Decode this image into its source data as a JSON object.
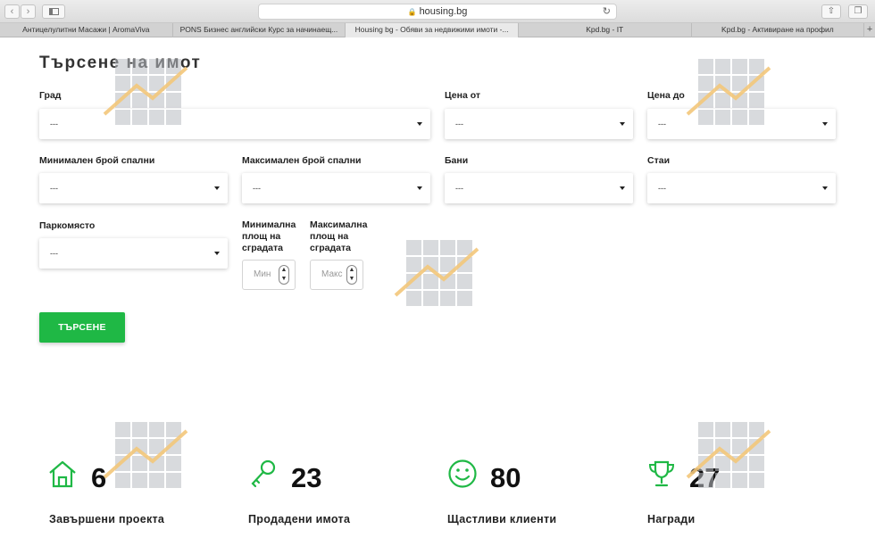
{
  "browser": {
    "url": "housing.bg",
    "tabs": [
      "Антицелулитни Масажи | AromaViva",
      "PONS Бизнес английски Курс за начинаещ...",
      "Housing bg - Обяви за недвижими имоти -...",
      "Kpd.bg - IT",
      "Kpd.bg - Активиране на профил"
    ],
    "active_tab": 2,
    "new_tab_label": "+"
  },
  "search": {
    "title": "Търсене на имот",
    "fields": {
      "city": {
        "label": "Град",
        "value": "---"
      },
      "price_from": {
        "label": "Цена от",
        "value": "---"
      },
      "price_to": {
        "label": "Цена до",
        "value": "---"
      },
      "min_bedrooms": {
        "label": "Минимален брой спални",
        "value": "---"
      },
      "max_bedrooms": {
        "label": "Максимален брой спални",
        "value": "---"
      },
      "bathrooms": {
        "label": "Бани",
        "value": "---"
      },
      "rooms": {
        "label": "Стаи",
        "value": "---"
      },
      "parking": {
        "label": "Паркомясто",
        "value": "---"
      },
      "min_area": {
        "label_lines": [
          "Минимална",
          "площ на",
          "сградата"
        ],
        "placeholder": "Мин"
      },
      "max_area": {
        "label_lines": [
          "Максимална",
          "площ на",
          "сградата"
        ],
        "placeholder": "Макс"
      }
    },
    "submit_label": "ТЪРСЕНЕ"
  },
  "stats": [
    {
      "icon": "house-icon",
      "value": "6",
      "label": "Завършени проекта"
    },
    {
      "icon": "key-icon",
      "value": "23",
      "label": "Продадени имота"
    },
    {
      "icon": "smiley-icon",
      "value": "80",
      "label": "Щастливи клиенти"
    },
    {
      "icon": "trophy-icon",
      "value": "27",
      "label": "Награди"
    }
  ],
  "colors": {
    "accent": "#1fb845",
    "icon": "#1fb845"
  }
}
